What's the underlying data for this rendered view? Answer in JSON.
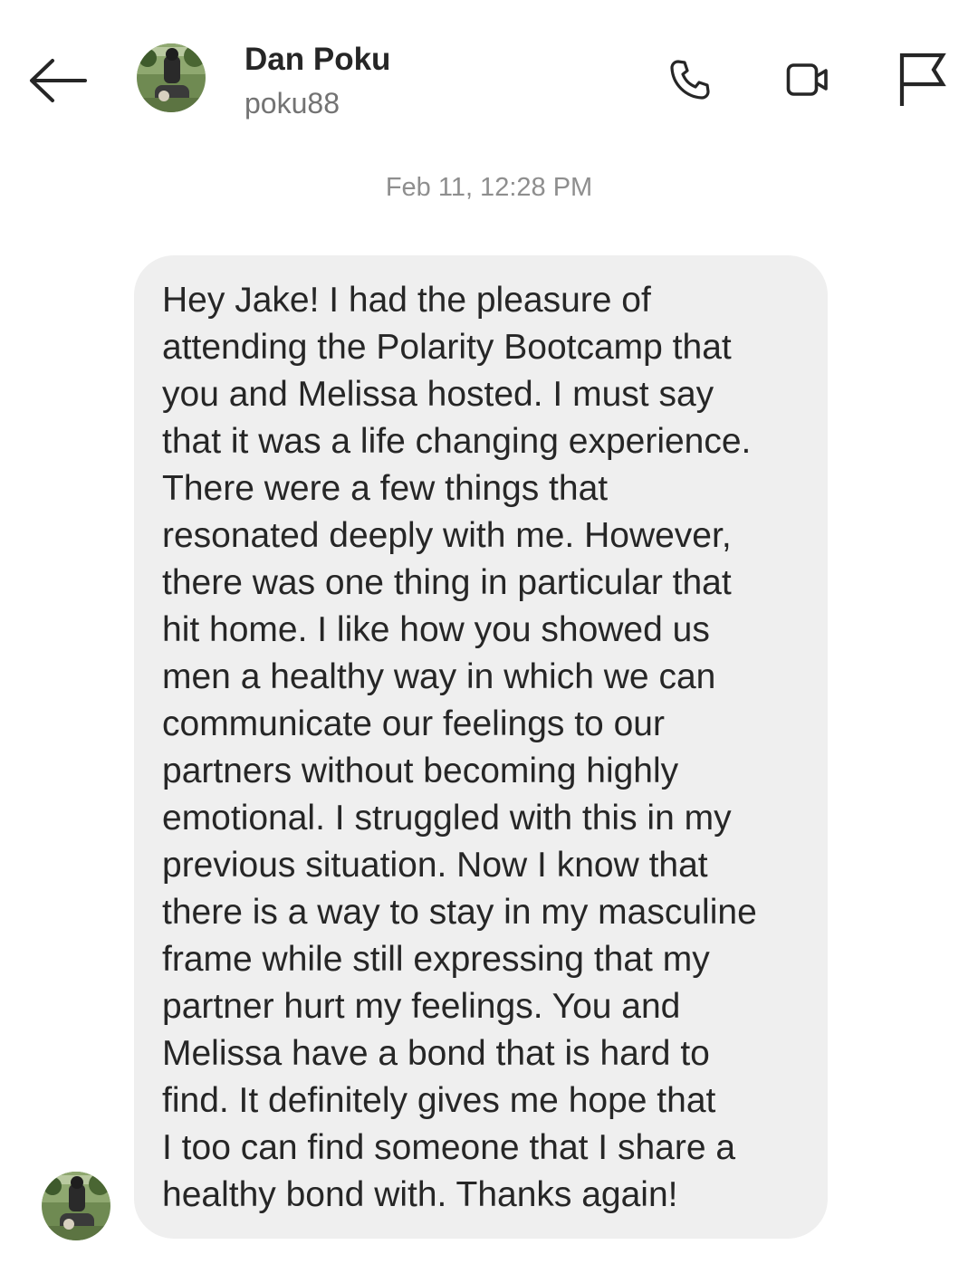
{
  "header": {
    "display_name": "Dan Poku",
    "username": "poku88",
    "icons": {
      "back": "arrow-left-icon",
      "call": "phone-icon",
      "video": "video-camera-icon",
      "report": "flag-icon"
    }
  },
  "thread": {
    "timestamp": "Feb 11, 12:28 PM",
    "message": {
      "text": "Hey Jake!  I had the pleasure of\nattending the Polarity Bootcamp that\nyou and Melissa hosted.  I must say\nthat it was a life changing experience.\nThere were a few things that\nresonated deeply with me.  However,\nthere was one thing in particular that\nhit home.  I like how you showed us\nmen a healthy way in which we can\ncommunicate our feelings to our\npartners without becoming highly\nemotional.  I struggled with this in my\nprevious situation.  Now I know that\nthere is a way to stay in my masculine\nframe while still expressing that my\npartner hurt my feelings.  You and\nMelissa have a bond that is hard to\nfind.  It definitely gives me hope that\nI too can find someone that I share a\nhealthy bond with.  Thanks again!",
      "bubble_color": "#efefef"
    }
  },
  "colors": {
    "text_primary": "#262626",
    "text_secondary": "#737373",
    "timestamp": "#8e8e8e"
  }
}
